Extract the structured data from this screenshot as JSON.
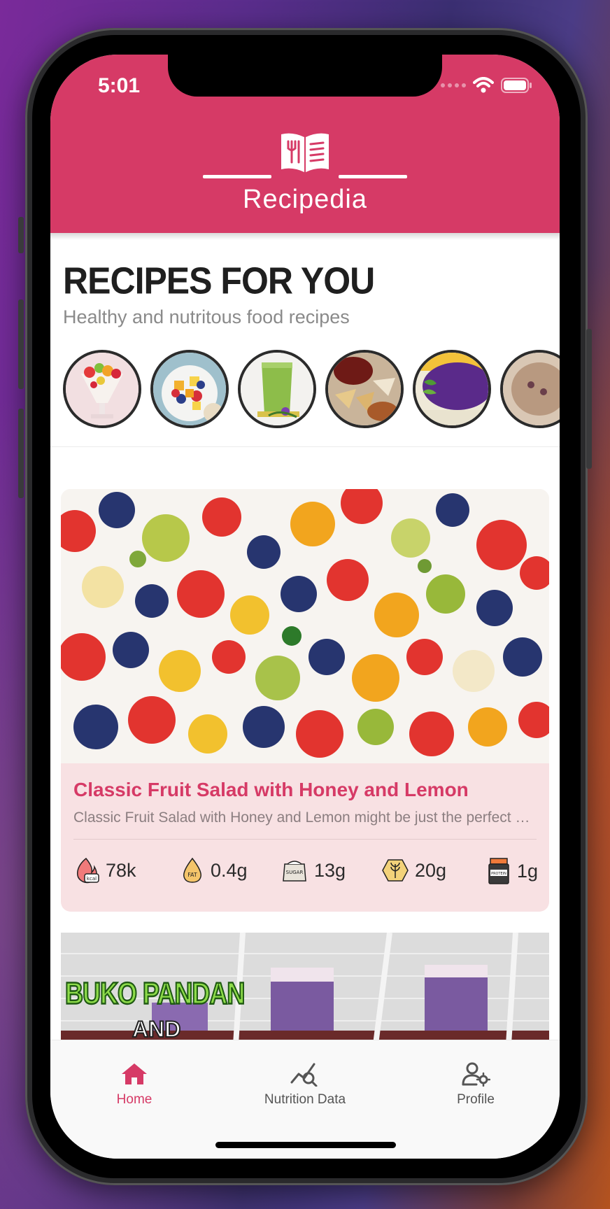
{
  "status_bar": {
    "time": "5:01"
  },
  "header": {
    "app_title": "Recipedia"
  },
  "section": {
    "title": "RECIPES FOR YOU",
    "subtitle": "Healthy and nutritous food recipes"
  },
  "featured_recipe": {
    "title": "Classic Fruit Salad with Honey and Lemon",
    "description": "Classic Fruit Salad with Honey and Lemon might be just the perfect dessert",
    "stats": {
      "calories": "78k",
      "fat": "0.4g",
      "sugar": "13g",
      "carbs": "20g",
      "protein": "1g"
    }
  },
  "next_recipe": {
    "image_text_1": "BUKO PANDAN",
    "image_text_2": "AND"
  },
  "tabbar": {
    "home": "Home",
    "nutrition": "Nutrition Data",
    "profile": "Profile"
  },
  "colors": {
    "accent": "#d63a66",
    "card_bg": "#f8e1e3"
  }
}
